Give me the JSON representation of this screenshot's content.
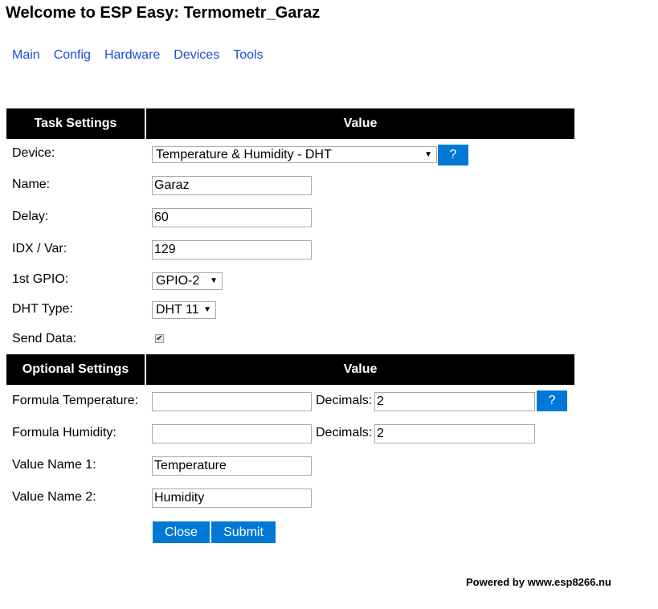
{
  "title": "Welcome to ESP Easy: Termometr_Garaz",
  "nav": {
    "main": "Main",
    "config": "Config",
    "hardware": "Hardware",
    "devices": "Devices",
    "tools": "Tools"
  },
  "task_header": {
    "col1": "Task Settings",
    "col2": "Value"
  },
  "device": {
    "label": "Device:",
    "value": "Temperature & Humidity - DHT",
    "help": "?"
  },
  "name": {
    "label": "Name:",
    "value": "Garaz"
  },
  "delay": {
    "label": "Delay:",
    "value": "60"
  },
  "idx": {
    "label": "IDX / Var:",
    "value": "129"
  },
  "gpio": {
    "label": "1st GPIO:",
    "value": "GPIO-2"
  },
  "dht_type": {
    "label": "DHT Type:",
    "value": "DHT 11"
  },
  "send_data": {
    "label": "Send Data:",
    "checked": true
  },
  "optional_header": {
    "col1": "Optional Settings",
    "col2": "Value"
  },
  "formula_temperature": {
    "label": "Formula Temperature:",
    "value": "",
    "decimals_label": "Decimals:",
    "decimals": "2",
    "help": "?"
  },
  "formula_humidity": {
    "label": "Formula Humidity:",
    "value": "",
    "decimals_label": "Decimals:",
    "decimals": "2"
  },
  "value_name_1": {
    "label": "Value Name 1:",
    "value": "Temperature"
  },
  "value_name_2": {
    "label": "Value Name 2:",
    "value": "Humidity"
  },
  "buttons": {
    "close": "Close",
    "submit": "Submit"
  },
  "footer": "Powered by www.esp8266.nu",
  "colors": {
    "header_bg": "#000000",
    "header_text": "#ffffff",
    "button_bg": "#0079d6",
    "link": "#1d4dd8"
  },
  "icons": {
    "checkbox": "check-icon",
    "dropdown": "dropdown-caret-icon"
  }
}
